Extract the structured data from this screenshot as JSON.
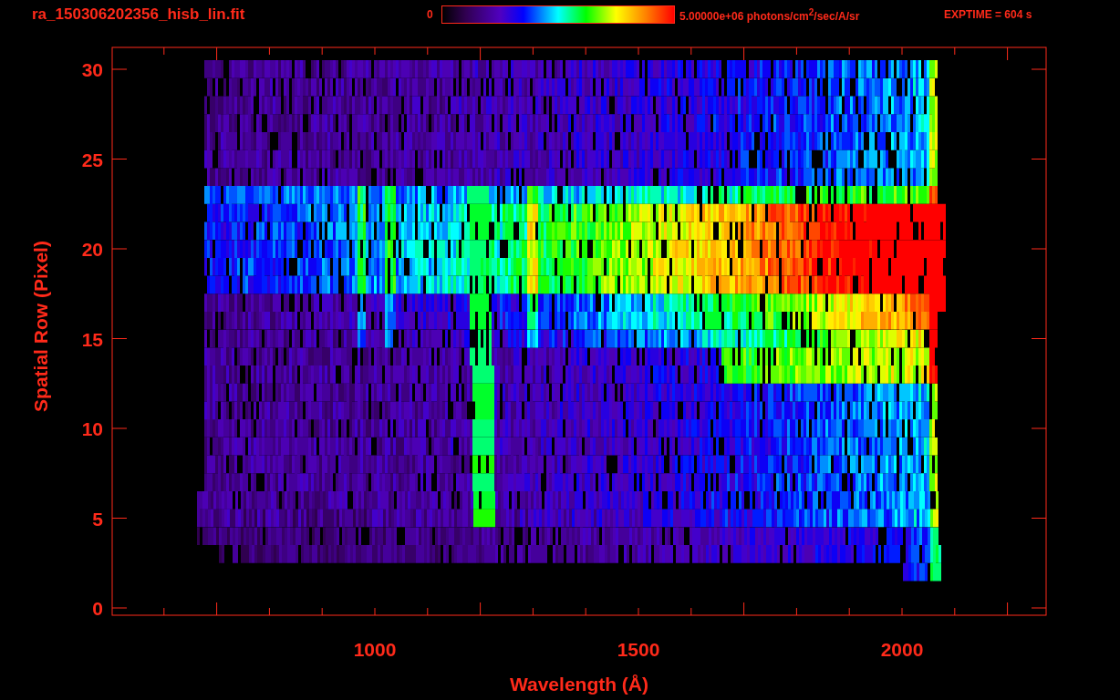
{
  "title": "ra_150306202356_hisb_lin.fit",
  "colorbar": {
    "min_label": "0",
    "max_label": "5.00000e+06 photons/cm$^{2}$/sec/A/sr"
  },
  "exptime": "EXPTIME = 604 s",
  "plot": {
    "xlabel": "Wavelength (Å)",
    "ylabel": "Spatial Row (Pixel)",
    "xticks": [
      "1000",
      "1500",
      "2000"
    ],
    "yticks": [
      "30",
      "25",
      "20",
      "15",
      "10",
      "5",
      "0"
    ]
  }
}
